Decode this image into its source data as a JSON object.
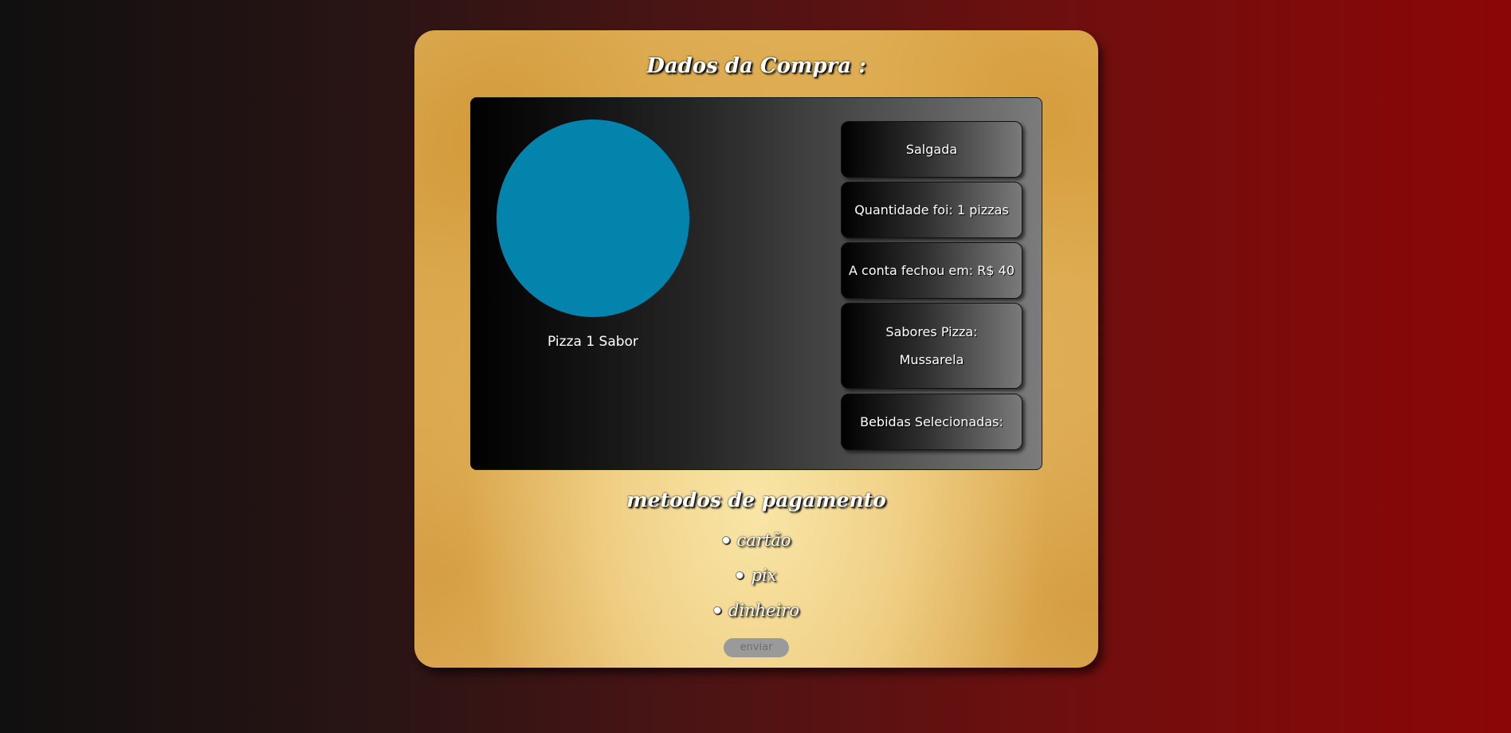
{
  "page": {
    "title": "Dados da Compra :"
  },
  "order": {
    "pizza_label": "Pizza 1 Sabor",
    "pizza_color": "#0384ad",
    "type": "Salgada",
    "quantity": "Quantidade foi: 1 pizzas",
    "total": "A conta fechou em: R$ 40",
    "flavors_label": "Sabores Pizza:",
    "flavors_value": "Mussarela",
    "drinks_label": "Bebidas Selecionadas:"
  },
  "payment": {
    "title": "metodos de pagamento",
    "options": [
      {
        "label": "cartão",
        "checked": false
      },
      {
        "label": "pix",
        "checked": false
      },
      {
        "label": "dinheiro",
        "checked": false
      }
    ],
    "submit_label": "enviar"
  }
}
